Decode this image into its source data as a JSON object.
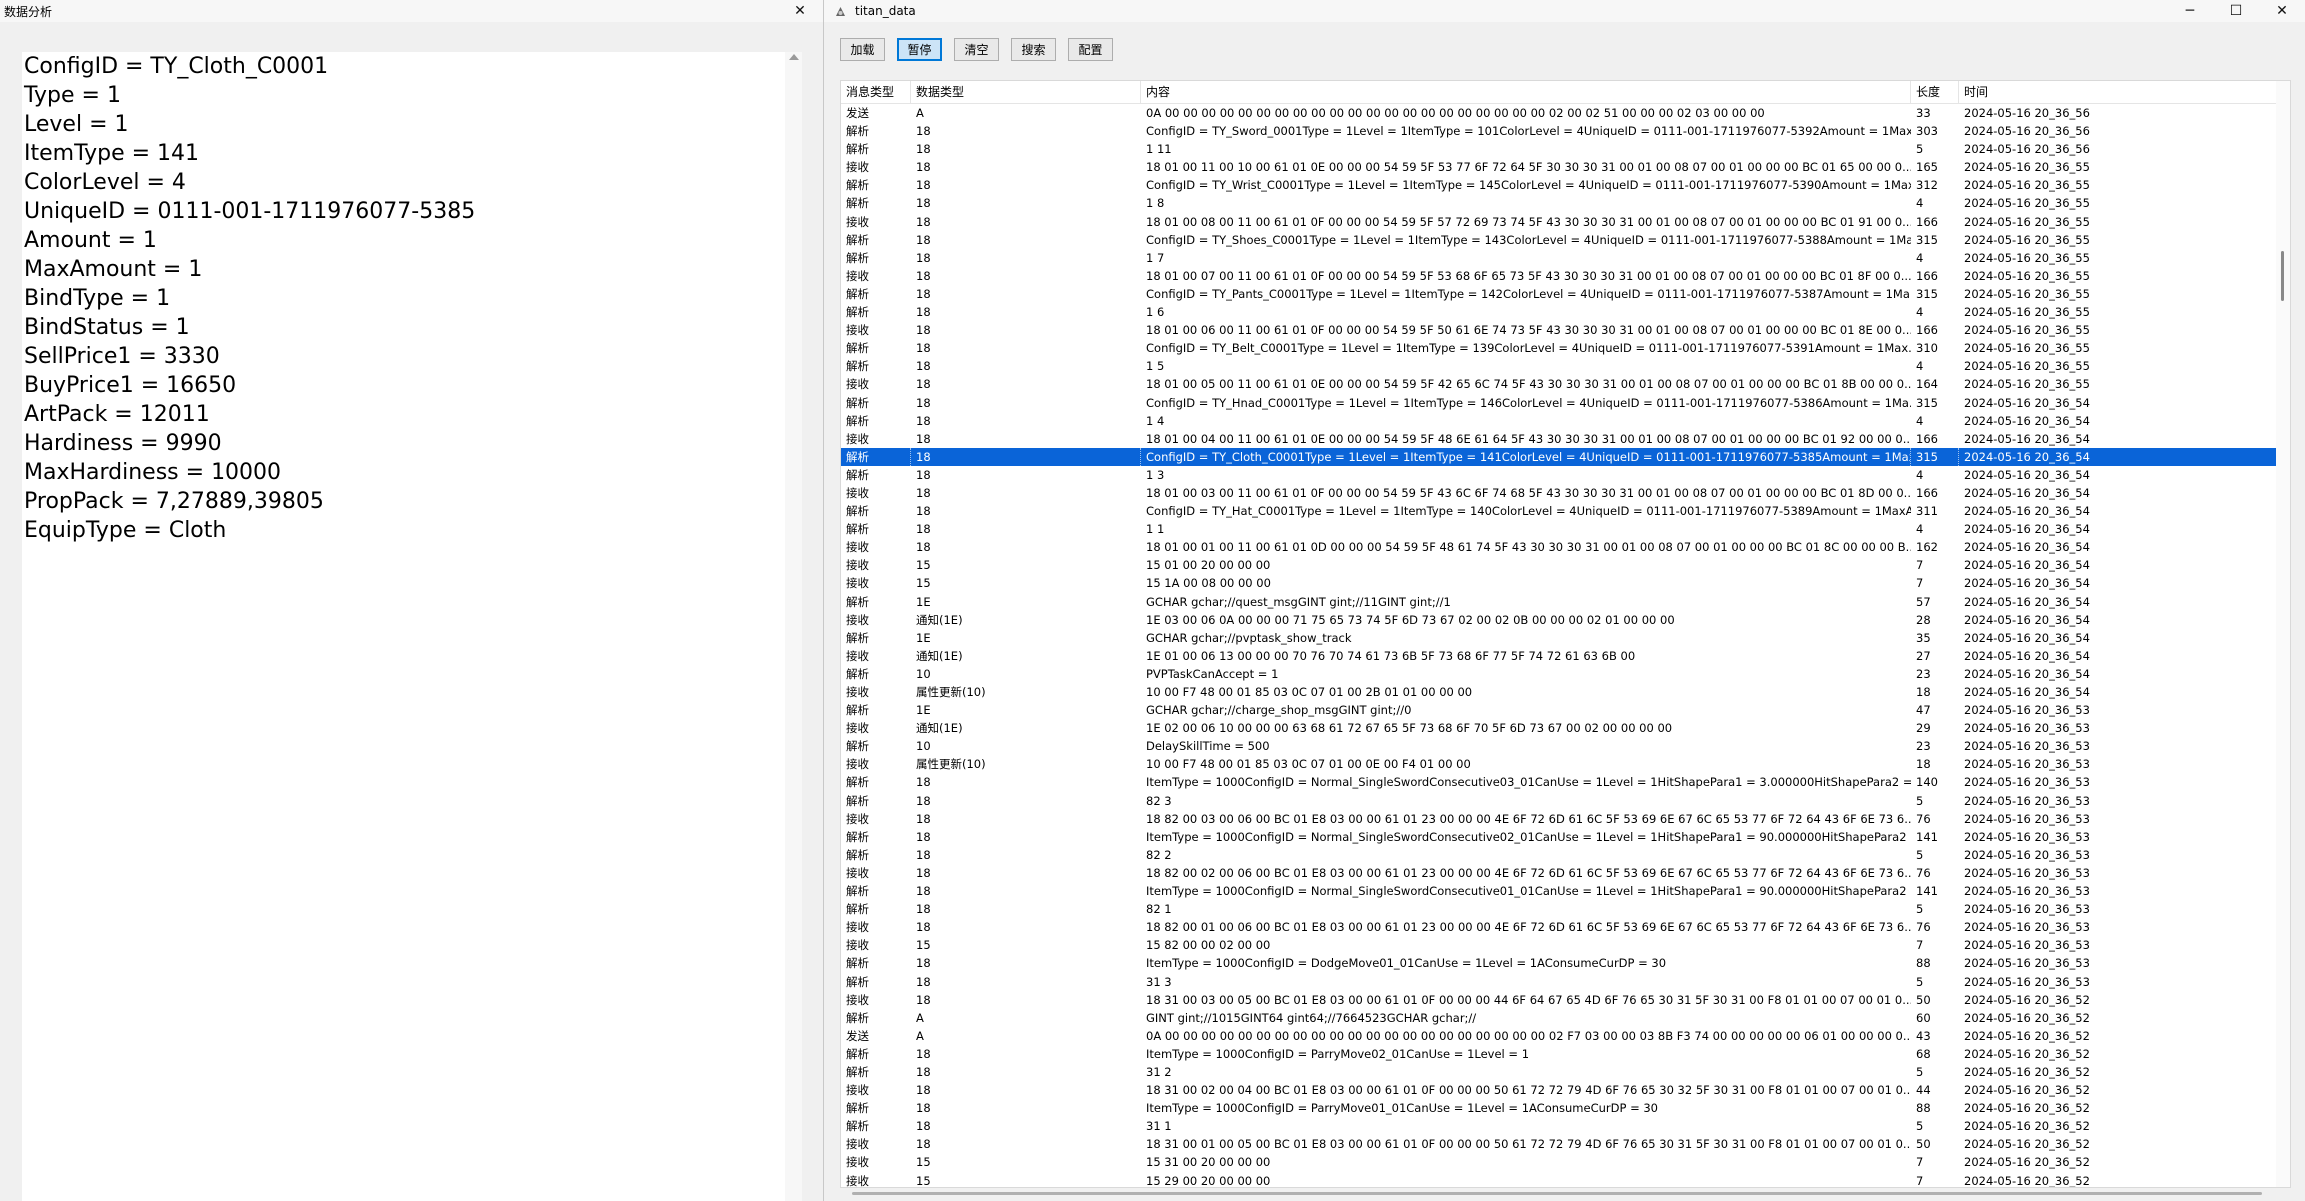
{
  "left_window": {
    "title": "数据分析",
    "close": "✕",
    "fields": [
      "ConfigID = TY_Cloth_C0001",
      "Type = 1",
      "Level = 1",
      "ItemType = 141",
      "ColorLevel = 4",
      "UniqueID = 0111-001-1711976077-5385",
      "Amount = 1",
      "MaxAmount = 1",
      "BindType = 1",
      "BindStatus = 1",
      "SellPrice1 = 3330",
      "BuyPrice1 = 16650",
      "ArtPack = 12011",
      "Hardiness = 9990",
      "MaxHardiness = 10000",
      "PropPack = 7,27889,39805",
      "EquipType = Cloth"
    ]
  },
  "right_window": {
    "title": "titan_data",
    "minimize": "─",
    "maximize": "☐",
    "close": "✕",
    "toolbar": [
      "加载",
      "暂停",
      "清空",
      "搜索",
      "配置"
    ],
    "active_button_index": 1,
    "columns": [
      "消息类型",
      "数据类型",
      "内容",
      "长度",
      "时间"
    ],
    "selected_row_index": 19,
    "rows": [
      [
        "发送",
        "A",
        "0A 00 00 00 00 00 00 00 00 00 00 00 00 00 00 00 00 00 00 00 00 00 02 00 02 51 00 00 00 02 03 00 00 00",
        "33",
        "2024-05-16 20_36_56"
      ],
      [
        "解析",
        "18",
        "ConfigID = TY_Sword_0001Type = 1Level = 1ItemType = 101ColorLevel = 4UniqueID = 0111-001-1711976077-5392Amount = 1Max...",
        "303",
        "2024-05-16 20_36_56"
      ],
      [
        "解析",
        "18",
        "1 11",
        "5",
        "2024-05-16 20_36_56"
      ],
      [
        "接收",
        "18",
        "18 01 00 11 00 10 00 61 01 0E 00 00 00 54 59 5F 53 77 6F 72 64 5F 30 30 30 31 00 01 00 08 07 00 01 00 00 00 BC 01 65 00 00 0...",
        "165",
        "2024-05-16 20_36_55"
      ],
      [
        "解析",
        "18",
        "ConfigID = TY_Wrist_C0001Type = 1Level = 1ItemType = 145ColorLevel = 4UniqueID = 0111-001-1711976077-5390Amount = 1Max...",
        "312",
        "2024-05-16 20_36_55"
      ],
      [
        "解析",
        "18",
        "1 8",
        "4",
        "2024-05-16 20_36_55"
      ],
      [
        "接收",
        "18",
        "18 01 00 08 00 11 00 61 01 0F 00 00 00 54 59 5F 57 72 69 73 74 5F 43 30 30 30 31 00 01 00 08 07 00 01 00 00 00 BC 01 91 00 0...",
        "166",
        "2024-05-16 20_36_55"
      ],
      [
        "解析",
        "18",
        "ConfigID = TY_Shoes_C0001Type = 1Level = 1ItemType = 143ColorLevel = 4UniqueID = 0111-001-1711976077-5388Amount = 1Ma...",
        "315",
        "2024-05-16 20_36_55"
      ],
      [
        "解析",
        "18",
        "1 7",
        "4",
        "2024-05-16 20_36_55"
      ],
      [
        "接收",
        "18",
        "18 01 00 07 00 11 00 61 01 0F 00 00 00 54 59 5F 53 68 6F 65 73 5F 43 30 30 30 31 00 01 00 08 07 00 01 00 00 00 BC 01 8F 00 0...",
        "166",
        "2024-05-16 20_36_55"
      ],
      [
        "解析",
        "18",
        "ConfigID = TY_Pants_C0001Type = 1Level = 1ItemType = 142ColorLevel = 4UniqueID = 0111-001-1711976077-5387Amount = 1Ma...",
        "315",
        "2024-05-16 20_36_55"
      ],
      [
        "解析",
        "18",
        "1 6",
        "4",
        "2024-05-16 20_36_55"
      ],
      [
        "接收",
        "18",
        "18 01 00 06 00 11 00 61 01 0F 00 00 00 54 59 5F 50 61 6E 74 73 5F 43 30 30 30 31 00 01 00 08 07 00 01 00 00 00 BC 01 8E 00 0...",
        "166",
        "2024-05-16 20_36_55"
      ],
      [
        "解析",
        "18",
        "ConfigID = TY_Belt_C0001Type = 1Level = 1ItemType = 139ColorLevel = 4UniqueID = 0111-001-1711976077-5391Amount = 1Max...",
        "310",
        "2024-05-16 20_36_55"
      ],
      [
        "解析",
        "18",
        "1 5",
        "4",
        "2024-05-16 20_36_55"
      ],
      [
        "接收",
        "18",
        "18 01 00 05 00 11 00 61 01 0E 00 00 00 54 59 5F 42 65 6C 74 5F 43 30 30 30 31 00 01 00 08 07 00 01 00 00 00 BC 01 8B 00 00 0...",
        "164",
        "2024-05-16 20_36_55"
      ],
      [
        "解析",
        "18",
        "ConfigID = TY_Hnad_C0001Type = 1Level = 1ItemType = 146ColorLevel = 4UniqueID = 0111-001-1711976077-5386Amount = 1Ma...",
        "315",
        "2024-05-16 20_36_54"
      ],
      [
        "解析",
        "18",
        "1 4",
        "4",
        "2024-05-16 20_36_54"
      ],
      [
        "接收",
        "18",
        "18 01 00 04 00 11 00 61 01 0E 00 00 00 54 59 5F 48 6E 61 64 5F 43 30 30 30 31 00 01 00 08 07 00 01 00 00 00 BC 01 92 00 00 0...",
        "166",
        "2024-05-16 20_36_54"
      ],
      [
        "解析",
        "18",
        "ConfigID = TY_Cloth_C0001Type = 1Level = 1ItemType = 141ColorLevel = 4UniqueID = 0111-001-1711976077-5385Amount = 1Max...",
        "315",
        "2024-05-16 20_36_54"
      ],
      [
        "解析",
        "18",
        "1 3",
        "4",
        "2024-05-16 20_36_54"
      ],
      [
        "接收",
        "18",
        "18 01 00 03 00 11 00 61 01 0F 00 00 00 54 59 5F 43 6C 6F 74 68 5F 43 30 30 30 31 00 01 00 08 07 00 01 00 00 00 BC 01 8D 00 0...",
        "166",
        "2024-05-16 20_36_54"
      ],
      [
        "解析",
        "18",
        "ConfigID = TY_Hat_C0001Type = 1Level = 1ItemType = 140ColorLevel = 4UniqueID = 0111-001-1711976077-5389Amount = 1MaxA...",
        "311",
        "2024-05-16 20_36_54"
      ],
      [
        "解析",
        "18",
        "1 1",
        "4",
        "2024-05-16 20_36_54"
      ],
      [
        "接收",
        "18",
        "18 01 00 01 00 11 00 61 01 0D 00 00 00 54 59 5F 48 61 74 5F 43 30 30 30 31 00 01 00 08 07 00 01 00 00 00 BC 01 8C 00 00 00 B...",
        "162",
        "2024-05-16 20_36_54"
      ],
      [
        "接收",
        "15",
        "15 01 00 20 00 00 00",
        "7",
        "2024-05-16 20_36_54"
      ],
      [
        "接收",
        "15",
        "15 1A 00 08 00 00 00",
        "7",
        "2024-05-16 20_36_54"
      ],
      [
        "解析",
        "1E",
        "GCHAR gchar;//quest_msgGINT gint;//11GINT gint;//1",
        "57",
        "2024-05-16 20_36_54"
      ],
      [
        "接收",
        "通知(1E)",
        "1E 03 00 06 0A 00 00 00 71 75 65 73 74 5F 6D 73 67 02 00 02 0B 00 00 00 02 01 00 00 00",
        "28",
        "2024-05-16 20_36_54"
      ],
      [
        "解析",
        "1E",
        "GCHAR gchar;//pvptask_show_track",
        "35",
        "2024-05-16 20_36_54"
      ],
      [
        "接收",
        "通知(1E)",
        "1E 01 00 06 13 00 00 00 70 76 70 74 61 73 6B 5F 73 68 6F 77 5F 74 72 61 63 6B 00",
        "27",
        "2024-05-16 20_36_54"
      ],
      [
        "解析",
        "10",
        "PVPTaskCanAccept = 1",
        "23",
        "2024-05-16 20_36_54"
      ],
      [
        "接收",
        "属性更新(10)",
        "10 00 F7 48 00 01 85 03 0C 07 01 00 2B 01 01 00 00 00",
        "18",
        "2024-05-16 20_36_54"
      ],
      [
        "解析",
        "1E",
        "GCHAR gchar;//charge_shop_msgGINT gint;//0",
        "47",
        "2024-05-16 20_36_53"
      ],
      [
        "接收",
        "通知(1E)",
        "1E 02 00 06 10 00 00 00 63 68 61 72 67 65 5F 73 68 6F 70 5F 6D 73 67 00 02 00 00 00 00",
        "29",
        "2024-05-16 20_36_53"
      ],
      [
        "解析",
        "10",
        "DelaySkillTime = 500",
        "23",
        "2024-05-16 20_36_53"
      ],
      [
        "接收",
        "属性更新(10)",
        "10 00 F7 48 00 01 85 03 0C 07 01 00 0E 00 F4 01 00 00",
        "18",
        "2024-05-16 20_36_53"
      ],
      [
        "解析",
        "18",
        "ItemType = 1000ConfigID = Normal_SingleSwordConsecutive03_01CanUse = 1Level = 1HitShapePara1 = 3.000000HitShapePara2 = 8....",
        "140",
        "2024-05-16 20_36_53"
      ],
      [
        "解析",
        "18",
        "82 3",
        "5",
        "2024-05-16 20_36_53"
      ],
      [
        "接收",
        "18",
        "18 82 00 03 00 06 00 BC 01 E8 03 00 00 61 01 23 00 00 00 4E 6F 72 6D 61 6C 5F 53 69 6E 67 6C 65 53 77 6F 72 64 43 6F 6E 73 6...",
        "76",
        "2024-05-16 20_36_53"
      ],
      [
        "解析",
        "18",
        "ItemType = 1000ConfigID = Normal_SingleSwordConsecutive02_01CanUse = 1Level = 1HitShapePara1 = 90.000000HitShapePara2 = ...",
        "141",
        "2024-05-16 20_36_53"
      ],
      [
        "解析",
        "18",
        "82 2",
        "5",
        "2024-05-16 20_36_53"
      ],
      [
        "接收",
        "18",
        "18 82 00 02 00 06 00 BC 01 E8 03 00 00 61 01 23 00 00 00 4E 6F 72 6D 61 6C 5F 53 69 6E 67 6C 65 53 77 6F 72 64 43 6F 6E 73 6...",
        "76",
        "2024-05-16 20_36_53"
      ],
      [
        "解析",
        "18",
        "ItemType = 1000ConfigID = Normal_SingleSwordConsecutive01_01CanUse = 1Level = 1HitShapePara1 = 90.000000HitShapePara2 = ...",
        "141",
        "2024-05-16 20_36_53"
      ],
      [
        "解析",
        "18",
        "82 1",
        "5",
        "2024-05-16 20_36_53"
      ],
      [
        "接收",
        "18",
        "18 82 00 01 00 06 00 BC 01 E8 03 00 00 61 01 23 00 00 00 4E 6F 72 6D 61 6C 5F 53 69 6E 67 6C 65 53 77 6F 72 64 43 6F 6E 73 6...",
        "76",
        "2024-05-16 20_36_53"
      ],
      [
        "接收",
        "15",
        "15 82 00 00 02 00 00",
        "7",
        "2024-05-16 20_36_53"
      ],
      [
        "解析",
        "18",
        "ItemType = 1000ConfigID = DodgeMove01_01CanUse = 1Level = 1AConsumeCurDP = 30",
        "88",
        "2024-05-16 20_36_53"
      ],
      [
        "解析",
        "18",
        "31 3",
        "5",
        "2024-05-16 20_36_53"
      ],
      [
        "接收",
        "18",
        "18 31 00 03 00 05 00 BC 01 E8 03 00 00 61 01 0F 00 00 00 44 6F 64 67 65 4D 6F 76 65 30 31 5F 30 31 00 F8 01 01 00 07 00 01 0...",
        "50",
        "2024-05-16 20_36_52"
      ],
      [
        "解析",
        "A",
        "GINT gint;//1015GINT64 gint64;//7664523GCHAR gchar;//",
        "60",
        "2024-05-16 20_36_52"
      ],
      [
        "发送",
        "A",
        "0A 00 00 00 00 00 00 00 00 00 00 00 00 00 00 00 00 00 00 00 00 00 02 F7 03 00 00 03 8B F3 74 00 00 00 00 00 06 01 00 00 00 0...",
        "43",
        "2024-05-16 20_36_52"
      ],
      [
        "解析",
        "18",
        "ItemType = 1000ConfigID = ParryMove02_01CanUse = 1Level = 1",
        "68",
        "2024-05-16 20_36_52"
      ],
      [
        "解析",
        "18",
        "31 2",
        "5",
        "2024-05-16 20_36_52"
      ],
      [
        "接收",
        "18",
        "18 31 00 02 00 04 00 BC 01 E8 03 00 00 61 01 0F 00 00 00 50 61 72 72 79 4D 6F 76 65 30 32 5F 30 31 00 F8 01 01 00 07 00 01 0...",
        "44",
        "2024-05-16 20_36_52"
      ],
      [
        "解析",
        "18",
        "ItemType = 1000ConfigID = ParryMove01_01CanUse = 1Level = 1AConsumeCurDP = 30",
        "88",
        "2024-05-16 20_36_52"
      ],
      [
        "解析",
        "18",
        "31 1",
        "5",
        "2024-05-16 20_36_52"
      ],
      [
        "接收",
        "18",
        "18 31 00 01 00 05 00 BC 01 E8 03 00 00 61 01 0F 00 00 00 50 61 72 72 79 4D 6F 76 65 30 31 5F 30 31 00 F8 01 01 00 07 00 01 0...",
        "50",
        "2024-05-16 20_36_52"
      ],
      [
        "接收",
        "15",
        "15 31 00 20 00 00 00",
        "7",
        "2024-05-16 20_36_52"
      ],
      [
        "接收",
        "15",
        "15 29 00 20 00 00 00",
        "7",
        "2024-05-16 20_36_52"
      ]
    ]
  }
}
